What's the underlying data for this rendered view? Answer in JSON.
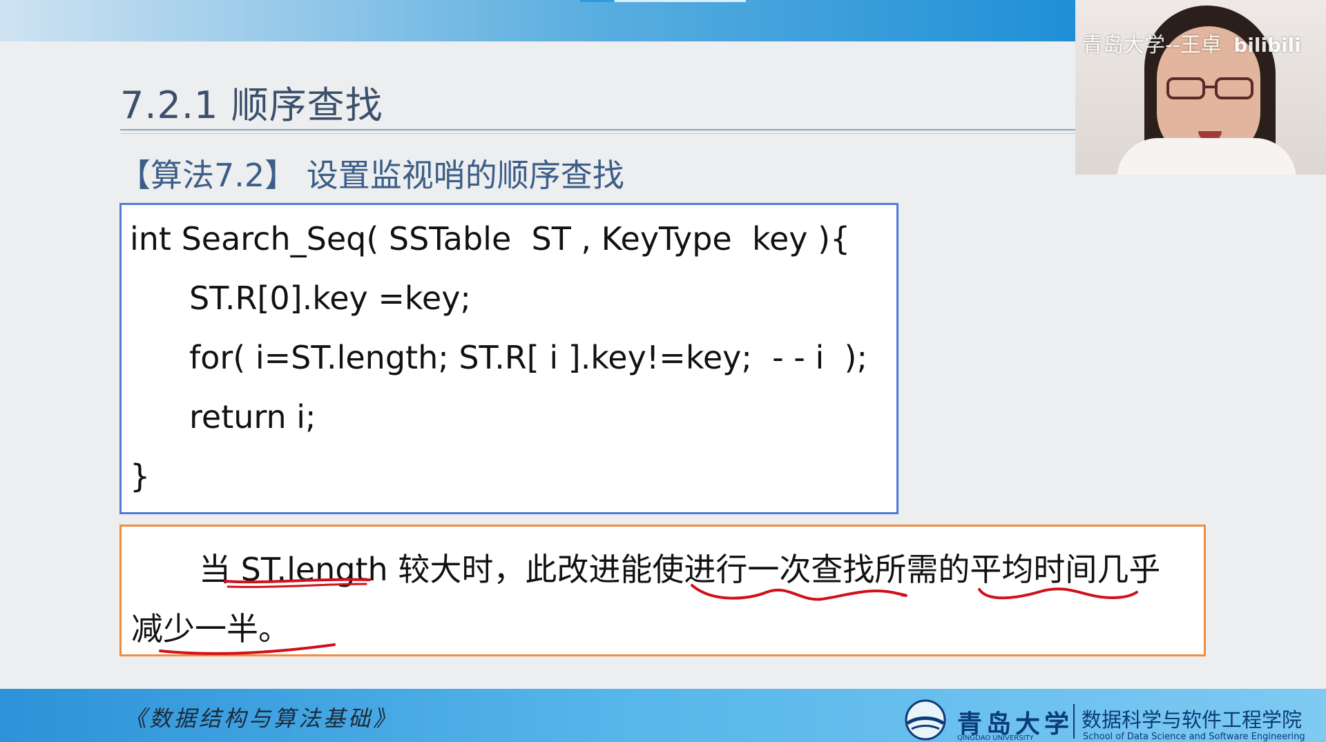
{
  "slide": {
    "title": "7.2.1 顺序查找",
    "subtitle": "【算法7.2】 设置监视哨的顺序查找"
  },
  "code": {
    "lines": [
      "int Search_Seq( SSTable  ST , KeyType  key ){",
      "ST.R[0].key =key;",
      "for( i=ST.length; ST.R[ i ].key!=key;  - - i  );",
      "return i;",
      "}"
    ]
  },
  "note": {
    "line1": "当 ST.length 较大时，此改进能使进行一次查找所需的平均时间几乎",
    "line2": "减少一半。"
  },
  "webcam": {
    "caption": "青岛大学--王卓",
    "watermark": "bilibili"
  },
  "footer": {
    "course": "《数据结构与算法基础》",
    "university_cn": "青岛大学",
    "university_en": "QINGDAO UNIVERSITY",
    "school_cn": "数据科学与软件工程学院",
    "school_en": "School of Data Science and Software Engineering"
  },
  "colors": {
    "code_border": "#4f7bd6",
    "note_border": "#f08c3c",
    "annotation": "#d0101a",
    "title": "#3b4f6b"
  }
}
